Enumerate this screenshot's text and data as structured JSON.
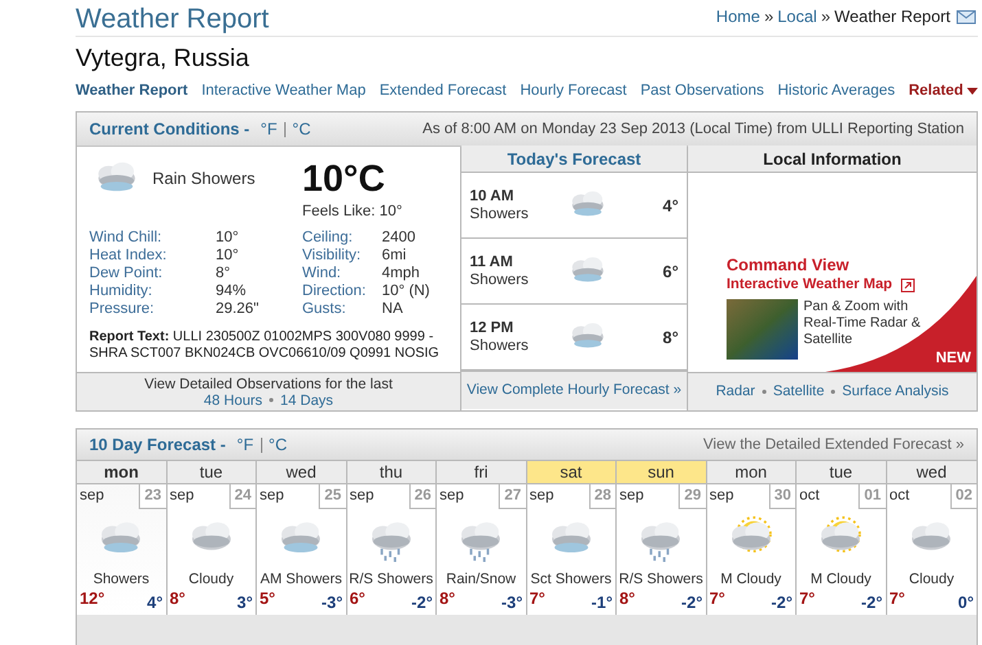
{
  "header": {
    "title": "Weather Report",
    "breadcrumb": [
      {
        "label": "Home",
        "current": false
      },
      {
        "label": "Local",
        "sep": "»",
        "current": false
      },
      {
        "label": "Weather Report",
        "sep": "»",
        "current": true
      }
    ]
  },
  "location": "Vytegra, Russia",
  "nav": [
    {
      "label": "Weather Report",
      "selected": true
    },
    {
      "label": "Interactive Weather Map",
      "selected": false
    },
    {
      "label": "Extended Forecast",
      "selected": false
    },
    {
      "label": "Hourly Forecast",
      "selected": false
    },
    {
      "label": "Past Observations",
      "selected": false
    },
    {
      "label": "Historic Averages",
      "selected": false
    }
  ],
  "related": {
    "label": "Related"
  },
  "current": {
    "title": "Current Conditions -",
    "units": [
      "°F",
      "°C"
    ],
    "as_of": "As of 8:00 AM on Monday 23 Sep 2013 (Local Time) from ULLI Reporting Station",
    "condition": "Rain Showers",
    "temp": "10°C",
    "feels_like": "Feels Like: 10°",
    "details_left": [
      {
        "label": "Wind Chill:",
        "value": "10°"
      },
      {
        "label": "Heat Index:",
        "value": "10°"
      },
      {
        "label": "Dew Point:",
        "value": "8°"
      },
      {
        "label": "Humidity:",
        "value": "94%"
      },
      {
        "label": "Pressure:",
        "value": "29.26\""
      }
    ],
    "details_right": [
      {
        "label": "Ceiling:",
        "value": "2400"
      },
      {
        "label": "Visibility:",
        "value": "6mi"
      },
      {
        "label": "Wind:",
        "value": "4mph"
      },
      {
        "label": "Direction:",
        "value": "10° (N)"
      },
      {
        "label": "Gusts:",
        "value": "NA"
      }
    ],
    "report": "**Report Text:** ULLI 230500Z 01002MPS 300V080 9999 -SHRA SCT007 BKN024CB OVC06610/09 Q0991 NOSIG",
    "footer_text": "View Detailed Observations for the last",
    "footer_links": [
      "48 Hours",
      "14 Days"
    ]
  },
  "today": {
    "title": "Today's Forecast",
    "rows": [
      {
        "time": "10 AM",
        "condition": "Showers",
        "temp": "4°"
      },
      {
        "time": "11 AM",
        "condition": "Showers",
        "temp": "6°"
      },
      {
        "time": "12 PM",
        "condition": "Showers",
        "temp": "8°"
      }
    ],
    "footer_link": "View Complete Hourly Forecast »"
  },
  "local": {
    "title": "Local Information",
    "ad_title": "Command View",
    "ad_subtitle": "Interactive Weather Map",
    "ad_text": "Pan & Zoom with Real-Time Radar & Satellite",
    "ad_badge": "NEW",
    "links": [
      "Radar",
      "Satellite",
      "Surface Analysis"
    ]
  },
  "ten_day": {
    "title": "10 Day Forecast -",
    "units": [
      "°F",
      "°C"
    ],
    "link": "View the Detailed Extended Forecast »",
    "days": [
      {
        "day": "mon",
        "month": "sep",
        "date": "23",
        "condition": "Showers",
        "high": "12°",
        "low": "4°",
        "kind": "showers",
        "today": true,
        "weekend": false
      },
      {
        "day": "tue",
        "month": "sep",
        "date": "24",
        "condition": "Cloudy",
        "high": "8°",
        "low": "3°",
        "kind": "cloudy",
        "today": false,
        "weekend": false
      },
      {
        "day": "wed",
        "month": "sep",
        "date": "25",
        "condition": "AM Showers",
        "high": "5°",
        "low": "-3°",
        "kind": "showers",
        "today": false,
        "weekend": false
      },
      {
        "day": "thu",
        "month": "sep",
        "date": "26",
        "condition": "R/S Showers",
        "high": "6°",
        "low": "-2°",
        "kind": "rain_snow",
        "today": false,
        "weekend": false
      },
      {
        "day": "fri",
        "month": "sep",
        "date": "27",
        "condition": "Rain/Snow",
        "high": "8°",
        "low": "-3°",
        "kind": "rain_snow",
        "today": false,
        "weekend": false
      },
      {
        "day": "sat",
        "month": "sep",
        "date": "28",
        "condition": "Sct Showers",
        "high": "7°",
        "low": "-1°",
        "kind": "showers",
        "today": false,
        "weekend": true
      },
      {
        "day": "sun",
        "month": "sep",
        "date": "29",
        "condition": "R/S Showers",
        "high": "8°",
        "low": "-2°",
        "kind": "rain_snow",
        "today": false,
        "weekend": true
      },
      {
        "day": "mon",
        "month": "sep",
        "date": "30",
        "condition": "M Cloudy",
        "high": "7°",
        "low": "-2°",
        "kind": "partly_sunny",
        "today": false,
        "weekend": false
      },
      {
        "day": "tue",
        "month": "oct",
        "date": "01",
        "condition": "M Cloudy",
        "high": "7°",
        "low": "-2°",
        "kind": "partly_sunny",
        "today": false,
        "weekend": false
      },
      {
        "day": "wed",
        "month": "oct",
        "date": "02",
        "condition": "Cloudy",
        "high": "7°",
        "low": "0°",
        "kind": "cloudy",
        "today": false,
        "weekend": false
      }
    ]
  }
}
